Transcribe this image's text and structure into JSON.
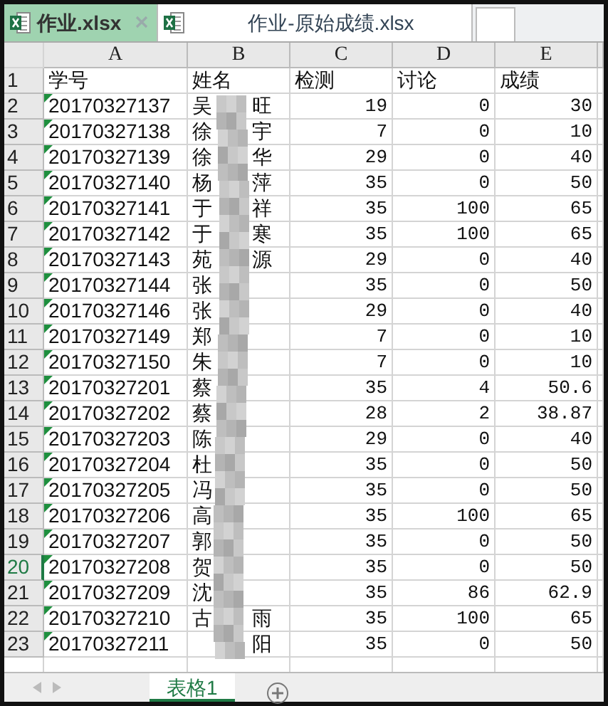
{
  "file_tabs": [
    {
      "label": "作业.xlsx",
      "selected": true,
      "closable": true
    },
    {
      "label": "作业-原始成绩.xlsx",
      "selected": false,
      "closable": false
    }
  ],
  "columns": [
    "A",
    "B",
    "C",
    "D",
    "E"
  ],
  "header_row": {
    "row": "1",
    "id": "学号",
    "name": "姓名",
    "c": "检测",
    "d": "讨论",
    "e": "成绩"
  },
  "rows": [
    {
      "row": "2",
      "id": "20170327137",
      "name_start": "吴",
      "name_end": "旺",
      "c": "19",
      "d": "0",
      "e": "30",
      "selected": false
    },
    {
      "row": "3",
      "id": "20170327138",
      "name_start": "徐",
      "name_end": "宇",
      "c": "7",
      "d": "0",
      "e": "10",
      "selected": false
    },
    {
      "row": "4",
      "id": "20170327139",
      "name_start": "徐",
      "name_end": "华",
      "c": "29",
      "d": "0",
      "e": "40",
      "selected": false
    },
    {
      "row": "5",
      "id": "20170327140",
      "name_start": "杨",
      "name_end": "萍",
      "c": "35",
      "d": "0",
      "e": "50",
      "selected": false
    },
    {
      "row": "6",
      "id": "20170327141",
      "name_start": "于",
      "name_end": "祥",
      "c": "35",
      "d": "100",
      "e": "65",
      "selected": false
    },
    {
      "row": "7",
      "id": "20170327142",
      "name_start": "于",
      "name_end": "寒",
      "c": "35",
      "d": "100",
      "e": "65",
      "selected": false
    },
    {
      "row": "8",
      "id": "20170327143",
      "name_start": "苑",
      "name_end": "源",
      "c": "29",
      "d": "0",
      "e": "40",
      "selected": false
    },
    {
      "row": "9",
      "id": "20170327144",
      "name_start": "张",
      "c": "35",
      "d": "0",
      "e": "50",
      "selected": false
    },
    {
      "row": "10",
      "id": "20170327146",
      "name_start": "张",
      "c": "29",
      "d": "0",
      "e": "40",
      "selected": false
    },
    {
      "row": "11",
      "id": "20170327149",
      "name_start": "郑",
      "c": "7",
      "d": "0",
      "e": "10",
      "selected": false
    },
    {
      "row": "12",
      "id": "20170327150",
      "name_start": "朱",
      "c": "7",
      "d": "0",
      "e": "10",
      "selected": false
    },
    {
      "row": "13",
      "id": "20170327201",
      "name_start": "蔡",
      "c": "35",
      "d": "4",
      "e": "50.6",
      "selected": false
    },
    {
      "row": "14",
      "id": "20170327202",
      "name_start": "蔡",
      "c": "28",
      "d": "2",
      "e": "38.87",
      "selected": false
    },
    {
      "row": "15",
      "id": "20170327203",
      "name_start": "陈",
      "c": "29",
      "d": "0",
      "e": "40",
      "selected": false
    },
    {
      "row": "16",
      "id": "20170327204",
      "name_start": "杜",
      "c": "35",
      "d": "0",
      "e": "50",
      "selected": false
    },
    {
      "row": "17",
      "id": "20170327205",
      "name_start": "冯",
      "c": "35",
      "d": "0",
      "e": "50",
      "selected": false
    },
    {
      "row": "18",
      "id": "20170327206",
      "name_start": "高",
      "c": "35",
      "d": "100",
      "e": "65",
      "selected": false
    },
    {
      "row": "19",
      "id": "20170327207",
      "name_start": "郭",
      "c": "35",
      "d": "0",
      "e": "50",
      "selected": false
    },
    {
      "row": "20",
      "id": "20170327208",
      "name_start": "贺",
      "c": "35",
      "d": "0",
      "e": "50",
      "selected": true
    },
    {
      "row": "21",
      "id": "20170327209",
      "name_start": "沈",
      "c": "35",
      "d": "86",
      "e": "62.9",
      "selected": false
    },
    {
      "row": "22",
      "id": "20170327210",
      "name_start": "古",
      "name_end": "雨",
      "c": "35",
      "d": "100",
      "e": "65",
      "selected": false
    },
    {
      "row": "23",
      "id": "20170327211",
      "name_end": "阳",
      "c": "35",
      "d": "0",
      "e": "50",
      "selected": false
    }
  ],
  "sheet_tabs": [
    {
      "label": "表格1",
      "selected": true
    }
  ]
}
